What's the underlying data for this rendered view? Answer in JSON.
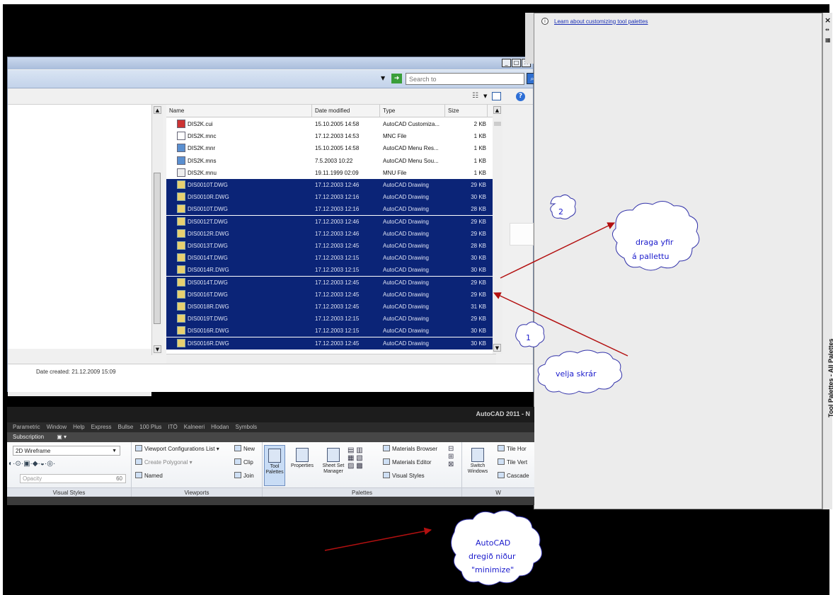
{
  "dialog": {
    "search_placeholder": "Search to",
    "columns": [
      "Name",
      "Date modified",
      "Type",
      "Size"
    ],
    "files": [
      {
        "name": "DIS2K.cui",
        "date": "15.10.2005 14:58",
        "type": "AutoCAD Customiza...",
        "size": "2 KB",
        "icon": "cui-file-icon",
        "selected": false
      },
      {
        "name": "DIS2K.mnc",
        "date": "17.12.2003 14:53",
        "type": "MNC File",
        "size": "1 KB",
        "icon": "blank-file-icon",
        "selected": false
      },
      {
        "name": "DIS2K.mnr",
        "date": "15.10.2005 14:58",
        "type": "AutoCAD Menu Res...",
        "size": "1 KB",
        "icon": "menu-resource-icon",
        "selected": false
      },
      {
        "name": "DIS2K.mns",
        "date": "7.5.2003 10:22",
        "type": "AutoCAD Menu Sou...",
        "size": "1 KB",
        "icon": "menu-source-icon",
        "selected": false
      },
      {
        "name": "DIS2K.mnu",
        "date": "19.11.1999 02:09",
        "type": "MNU File",
        "size": "1 KB",
        "icon": "mnu-file-icon",
        "selected": false
      },
      {
        "name": "DIS0010T.DWG",
        "date": "17.12.2003 12:46",
        "type": "AutoCAD Drawing",
        "size": "29 KB",
        "icon": "dwg-file-icon",
        "selected": true
      },
      {
        "name": "DIS0010R.DWG",
        "date": "17.12.2003 12:16",
        "type": "AutoCAD Drawing",
        "size": "30 KB",
        "icon": "dwg-file-icon",
        "selected": true
      },
      {
        "name": "DIS0010T.DWG",
        "date": "17.12.2003 12:16",
        "type": "AutoCAD Drawing",
        "size": "28 KB",
        "icon": "dwg-file-icon",
        "selected": true
      },
      {
        "name": "DIS0012T.DWG",
        "date": "17.12.2003 12:46",
        "type": "AutoCAD Drawing",
        "size": "29 KB",
        "icon": "dwg-file-icon",
        "selected": true
      },
      {
        "name": "DIS0012R.DWG",
        "date": "17.12.2003 12:46",
        "type": "AutoCAD Drawing",
        "size": "29 KB",
        "icon": "dwg-file-icon",
        "selected": true
      },
      {
        "name": "DIS0013T.DWG",
        "date": "17.12.2003 12:45",
        "type": "AutoCAD Drawing",
        "size": "28 KB",
        "icon": "dwg-file-icon",
        "selected": true
      },
      {
        "name": "DIS0014T.DWG",
        "date": "17.12.2003 12:15",
        "type": "AutoCAD Drawing",
        "size": "30 KB",
        "icon": "dwg-file-icon",
        "selected": true
      },
      {
        "name": "DIS0014R.DWG",
        "date": "17.12.2003 12:15",
        "type": "AutoCAD Drawing",
        "size": "30 KB",
        "icon": "dwg-file-icon",
        "selected": true
      },
      {
        "name": "DIS0014T.DWG",
        "date": "17.12.2003 12:45",
        "type": "AutoCAD Drawing",
        "size": "29 KB",
        "icon": "dwg-file-icon",
        "selected": true
      },
      {
        "name": "DIS0016T.DWG",
        "date": "17.12.2003 12:45",
        "type": "AutoCAD Drawing",
        "size": "29 KB",
        "icon": "dwg-file-icon",
        "selected": true
      },
      {
        "name": "DIS0018R.DWG",
        "date": "17.12.2003 12:45",
        "type": "AutoCAD Drawing",
        "size": "31 KB",
        "icon": "dwg-file-icon",
        "selected": true
      },
      {
        "name": "DIS0019T.DWG",
        "date": "17.12.2003 12:15",
        "type": "AutoCAD Drawing",
        "size": "29 KB",
        "icon": "dwg-file-icon",
        "selected": true
      },
      {
        "name": "DIS0016R.DWG",
        "date": "17.12.2003 12:15",
        "type": "AutoCAD Drawing",
        "size": "30 KB",
        "icon": "dwg-file-icon",
        "selected": true
      },
      {
        "name": "DIS0016R.DWG",
        "date": "17.12.2003 12:45",
        "type": "AutoCAD Drawing",
        "size": "30 KB",
        "icon": "dwg-file-icon",
        "selected": true
      }
    ],
    "date_created": "Date created: 21.12.2009 15:09"
  },
  "acad": {
    "title": "AutoCAD 2011 - N",
    "menu": [
      "Parametric",
      "Window",
      "Help",
      "Express",
      "Bullse",
      "100 Plus",
      "ITÖ",
      "Kalneeri",
      "Hlodan",
      "Symbols"
    ],
    "subscription": "Subscription",
    "visual_style": "2D Wireframe",
    "opacity_label": "Opacity",
    "opacity_value": "60",
    "viewport_config": "Viewport Configurations List",
    "create_polygonal": "Create Polygonal",
    "named": "Named",
    "new": "New",
    "clip": "Clip",
    "join": "Join",
    "tool_palettes": "Tool\nPalettes",
    "properties": "Properties",
    "sheet_set_manager": "Sheet Set\nManager",
    "materials_browser": "Materials Browser",
    "materials_editor": "Materials Editor",
    "visual_styles_btn": "Visual Styles",
    "switch_windows": "Switch\nWindows",
    "tile_horizontally": "Tile Hor",
    "tile_vertically": "Tile Vert",
    "cascade": "Cascade",
    "panel_visual_styles": "Visual Styles",
    "panel_viewports": "Viewports",
    "panel_palettes": "Palettes",
    "panel_windows": "W"
  },
  "palette": {
    "link": "Learn about customizing tool palettes",
    "vertical_title": "Tool Palettes - All Palettes"
  },
  "annotations": {
    "step1": "1",
    "step1_text": "velja skrár",
    "step2": "2",
    "step2_text_line1": "draga yfir",
    "step2_text_line2": "á pallettu",
    "minimize_line1": "AutoCAD",
    "minimize_line2": "dregið niður",
    "minimize_line3": "\"minimize\""
  }
}
